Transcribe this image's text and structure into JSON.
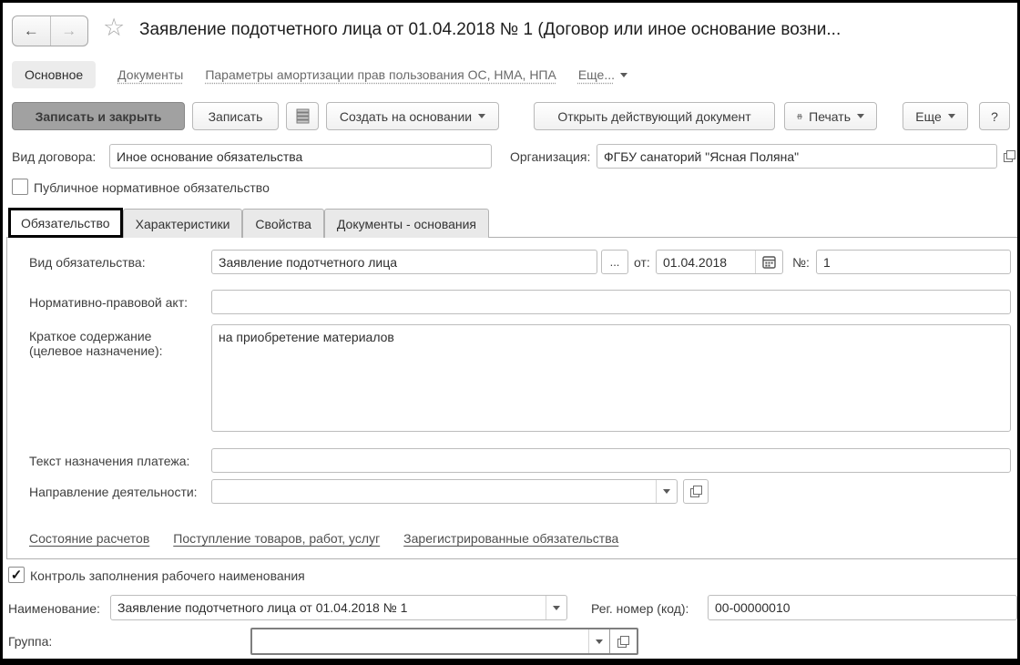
{
  "icons": {
    "back": "←",
    "forward": "→",
    "favorite": "☆",
    "ellipsis_button": "...",
    "check": "✓"
  },
  "window": {
    "title": "Заявление подотчетного лица от 01.04.2018 № 1 (Договор или иное основание возни..."
  },
  "nav": {
    "items": [
      {
        "label": "Основное"
      },
      {
        "label": "Документы"
      },
      {
        "label": "Параметры амортизации прав пользования ОС, НМА, НПА"
      },
      {
        "label": "Еще..."
      }
    ]
  },
  "toolbar": {
    "save_and_close": "Записать и закрыть",
    "save": "Записать",
    "create_based_on": "Создать на основании",
    "open_active_document": "Открыть действующий документ",
    "print": "Печать",
    "more": "Еще",
    "help": "?"
  },
  "header_fields": {
    "contract_type_label": "Вид договора:",
    "contract_type_value": "Иное основание обязательства",
    "organization_label": "Организация:",
    "organization_value": "ФГБУ санаторий \"Ясная Поляна\"",
    "public_normative_label": "Публичное нормативное обязательство",
    "public_normative_checked": false
  },
  "tabs": [
    {
      "label": "Обязательство",
      "active": true
    },
    {
      "label": "Характеристики",
      "active": false
    },
    {
      "label": "Свойства",
      "active": false
    },
    {
      "label": "Документы - основания",
      "active": false
    }
  ],
  "form": {
    "obligation_type_label": "Вид обязательства:",
    "obligation_type_value": "Заявление подотчетного лица",
    "date_label": "от:",
    "date_value": "01.04.2018",
    "number_label": "№:",
    "number_value": "1",
    "legal_act_label": "Нормативно-правовой акт:",
    "legal_act_value": "",
    "summary_label_line1": "Краткое содержание",
    "summary_label_line2": "(целевое назначение):",
    "summary_value": "на приобретение материалов",
    "payment_text_label": "Текст назначения платежа:",
    "payment_text_value": "",
    "activity_label": "Направление деятельности:",
    "activity_value": "",
    "links": [
      {
        "label": "Состояние расчетов"
      },
      {
        "label": "Поступление товаров, работ, услуг"
      },
      {
        "label": "Зарегистрированные обязательства"
      }
    ]
  },
  "footer": {
    "name_control_label": "Контроль заполнения рабочего наименования",
    "name_control_checked": true,
    "name_label": "Наименование:",
    "name_value": "Заявление подотчетного лица от 01.04.2018 № 1",
    "reg_number_label": "Рег. номер (код):",
    "reg_number_value": "00-00000010",
    "group_label": "Группа:",
    "group_value": ""
  },
  "colors": {
    "primary_button_bg": "#a1a1a1",
    "tab_inactive_bg": "#e9e9e9",
    "border": "#b5b5b5",
    "text": "#3c3c3c",
    "link": "#666666",
    "focus_border": "#000000"
  }
}
